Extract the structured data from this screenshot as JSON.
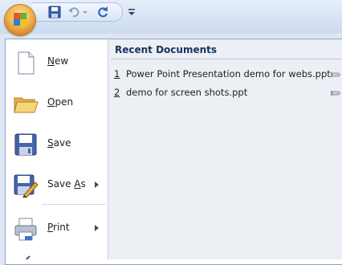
{
  "office_button": {
    "icon": "office-logo-icon"
  },
  "quick_access": {
    "items": [
      {
        "icon": "save-icon"
      },
      {
        "icon": "undo-icon"
      },
      {
        "icon": "redo-icon"
      },
      {
        "icon": "customize-dropdown-icon"
      }
    ]
  },
  "menu": {
    "commands": [
      {
        "mnemonic": "N",
        "rest": "ew",
        "icon": "new-document-icon",
        "submenu": false
      },
      {
        "mnemonic": "O",
        "rest": "pen",
        "icon": "open-folder-icon",
        "submenu": false
      },
      {
        "mnemonic": "S",
        "rest": "ave",
        "icon": "save-icon",
        "submenu": false
      },
      {
        "pre": "Save ",
        "mnemonic": "A",
        "rest": "s",
        "icon": "save-as-icon",
        "submenu": true
      },
      {
        "mnemonic": "P",
        "rest": "rint",
        "icon": "print-icon",
        "submenu": true
      }
    ]
  },
  "recent": {
    "title": "Recent Documents",
    "items": [
      {
        "num": "1",
        "name": "Power Point Presentation demo for webs.ppt"
      },
      {
        "num": "2",
        "name": "demo for screen shots.ppt"
      }
    ]
  },
  "colors": {
    "accent": "#15325f",
    "pane": "#eceff4",
    "border": "#8ba4c8"
  }
}
